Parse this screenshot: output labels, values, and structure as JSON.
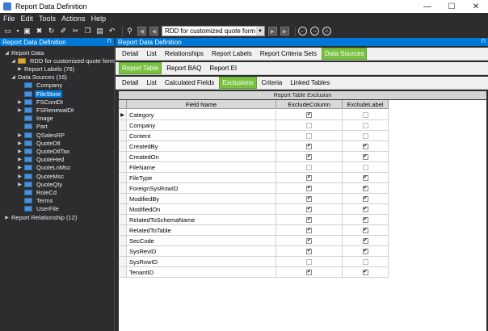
{
  "window": {
    "title": "Report Data Definition",
    "min": "—",
    "max": "☐",
    "close": "✕"
  },
  "menu": [
    "File",
    "Edit",
    "Tools",
    "Actions",
    "Help"
  ],
  "toolbar": {
    "combo_value": "RDD for customized quote form"
  },
  "left_pane": {
    "header": "Report Data Definition",
    "tree": [
      {
        "label": "Report Data",
        "level": 0,
        "exp": "◢",
        "icon": "none"
      },
      {
        "label": "RDD for customized quote form",
        "level": 1,
        "exp": "◢",
        "icon": "doc"
      },
      {
        "label": "Report Labels (76)",
        "level": 2,
        "exp": "▶",
        "icon": "none"
      },
      {
        "label": "Data Sources (16)",
        "level": 1,
        "exp": "◢",
        "icon": "none"
      },
      {
        "label": "Company",
        "level": 2,
        "exp": "",
        "icon": "table"
      },
      {
        "label": "FileStore",
        "level": 2,
        "exp": "",
        "icon": "table",
        "selected": true
      },
      {
        "label": "FSContDt",
        "level": 2,
        "exp": "▶",
        "icon": "table"
      },
      {
        "label": "FSRenewalDt",
        "level": 2,
        "exp": "▶",
        "icon": "table"
      },
      {
        "label": "Image",
        "level": 2,
        "exp": "",
        "icon": "table"
      },
      {
        "label": "Part",
        "level": 2,
        "exp": "",
        "icon": "table"
      },
      {
        "label": "QSalesRP",
        "level": 2,
        "exp": "▶",
        "icon": "table"
      },
      {
        "label": "QuoteDtl",
        "level": 2,
        "exp": "▶",
        "icon": "table"
      },
      {
        "label": "QuoteDtlTax",
        "level": 2,
        "exp": "▶",
        "icon": "table"
      },
      {
        "label": "QuoteHed",
        "level": 2,
        "exp": "▶",
        "icon": "table"
      },
      {
        "label": "QuoteLnMsc",
        "level": 2,
        "exp": "▶",
        "icon": "table"
      },
      {
        "label": "QuoteMsc",
        "level": 2,
        "exp": "▶",
        "icon": "table"
      },
      {
        "label": "QuoteQty",
        "level": 2,
        "exp": "▶",
        "icon": "table"
      },
      {
        "label": "RoleCd",
        "level": 2,
        "exp": "",
        "icon": "table"
      },
      {
        "label": "Terms",
        "level": 2,
        "exp": "",
        "icon": "table"
      },
      {
        "label": "UserFile",
        "level": 2,
        "exp": "",
        "icon": "table"
      },
      {
        "label": "Report Relationship (12)",
        "level": 0,
        "exp": "▶",
        "icon": "none"
      }
    ]
  },
  "main_pane": {
    "header": "Report Data Definition",
    "tabs1": [
      {
        "label": "Detail"
      },
      {
        "label": "List"
      },
      {
        "label": "Relationships"
      },
      {
        "label": "Report Labels"
      },
      {
        "label": "Report Criteria Sets"
      },
      {
        "label": "Data Sources",
        "active": true
      }
    ],
    "tabs2": [
      {
        "label": "Report Table",
        "active": true
      },
      {
        "label": "Report BAQ"
      },
      {
        "label": "Report EI"
      }
    ],
    "tabs3": [
      {
        "label": "Detail"
      },
      {
        "label": "List"
      },
      {
        "label": "Calculated Fields"
      },
      {
        "label": "Exclusions",
        "active": true
      },
      {
        "label": "Criteria"
      },
      {
        "label": "Linked Tables"
      }
    ],
    "table": {
      "caption": "Report Table Exclusion",
      "columns": [
        "Field Name",
        "ExcludeColumn",
        "ExcludeLabel"
      ],
      "rows": [
        {
          "field": "Category",
          "col": true,
          "lbl": false,
          "current": true
        },
        {
          "field": "Company",
          "col": false,
          "lbl": false
        },
        {
          "field": "Content",
          "col": false,
          "lbl": false
        },
        {
          "field": "CreatedBy",
          "col": true,
          "lbl": true
        },
        {
          "field": "CreatedOn",
          "col": true,
          "lbl": true
        },
        {
          "field": "FileName",
          "col": false,
          "lbl": false
        },
        {
          "field": "FileType",
          "col": true,
          "lbl": true
        },
        {
          "field": "ForeignSysRowID",
          "col": true,
          "lbl": true
        },
        {
          "field": "ModifiedBy",
          "col": true,
          "lbl": true
        },
        {
          "field": "ModifiedOn",
          "col": true,
          "lbl": true
        },
        {
          "field": "RelatedToSchemaName",
          "col": true,
          "lbl": true
        },
        {
          "field": "RelatedToTable",
          "col": true,
          "lbl": true
        },
        {
          "field": "SecCode",
          "col": true,
          "lbl": true
        },
        {
          "field": "SysRevID",
          "col": true,
          "lbl": true
        },
        {
          "field": "SysRowID",
          "col": false,
          "lbl": false
        },
        {
          "field": "TenantID",
          "col": true,
          "lbl": true
        }
      ]
    }
  },
  "icons": {
    "check": "✔",
    "row_pointer": "▶",
    "pin": "⊓"
  }
}
